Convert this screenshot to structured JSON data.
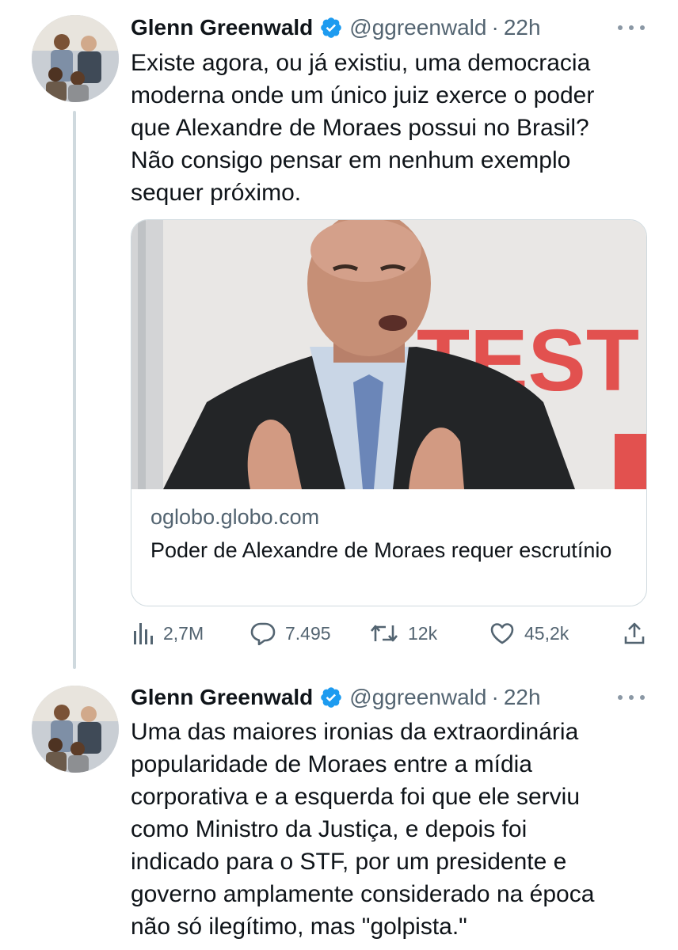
{
  "tweets": [
    {
      "author": "Glenn Greenwald",
      "handle": "@ggreenwald",
      "separator": "·",
      "time": "22h",
      "text": "Existe agora, ou já existiu, uma democracia\nmoderna onde um único juiz exerce o poder\nque Alexandre de Moraes possui no Brasil?\nNão consigo pensar em nenhum exemplo\nsequer próximo.",
      "card": {
        "domain": "oglobo.globo.com",
        "title": "Poder de Alexandre de Moraes requer escrutínio",
        "image_background_text": "TEST"
      },
      "stats": {
        "views": "2,7M",
        "replies": "7.495",
        "retweets": "12k",
        "likes": "45,2k"
      }
    },
    {
      "author": "Glenn Greenwald",
      "handle": "@ggreenwald",
      "separator": "·",
      "time": "22h",
      "text": "Uma das maiores ironias da extraordinária\npopularidade de Moraes entre a mídia\ncorporativa e a esquerda foi que ele serviu\ncomo Ministro da Justiça, e depois foi\nindicado para o STF, por um presidente e\ngoverno amplamente considerado na época\nnão só ilegítimo, mas \"golpista.\""
    }
  ],
  "icons": {
    "verified": "verified-badge-icon",
    "more": "more-options-icon",
    "views": "views-icon",
    "reply": "reply-icon",
    "retweet": "retweet-icon",
    "like": "like-icon",
    "share": "share-icon"
  },
  "colors": {
    "text": "#0f1419",
    "secondary": "#536471",
    "verified_blue": "#1d9bf0",
    "border": "#cfd9de"
  }
}
